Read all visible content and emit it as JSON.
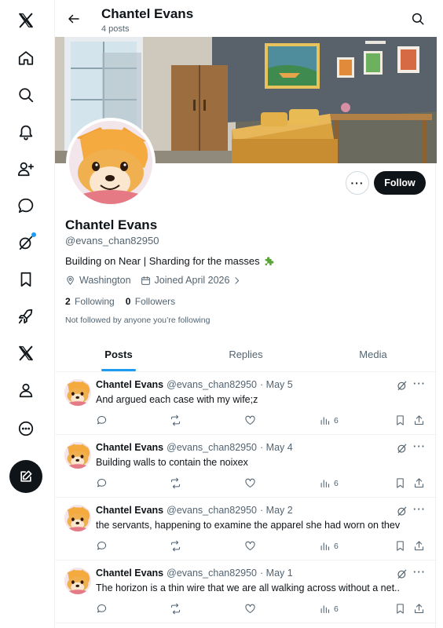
{
  "header": {
    "name": "Chantel Evans",
    "post_count": "4 posts"
  },
  "profile": {
    "name": "Chantel Evans",
    "handle": "@evans_chan82950",
    "bio": "Building on Near | Sharding for the masses",
    "location": "Washington",
    "joined": "Joined April 2026",
    "following_count": "2",
    "following_label": "Following",
    "followers_count": "0",
    "followers_label": "Followers",
    "not_followed_text": "Not followed by anyone you’re following",
    "follow_label": "Follow"
  },
  "tabs": [
    {
      "label": "Posts",
      "active": true
    },
    {
      "label": "Replies",
      "active": false
    },
    {
      "label": "Media",
      "active": false
    }
  ],
  "posts": [
    {
      "name": "Chantel Evans",
      "handle": "@evans_chan82950",
      "date": "· May 5",
      "text": "And argued each case with my wife;z",
      "views": "6"
    },
    {
      "name": "Chantel Evans",
      "handle": "@evans_chan82950",
      "date": "· May 4",
      "text": "Building walls to contain the noixex",
      "views": "6"
    },
    {
      "name": "Chantel Evans",
      "handle": "@evans_chan82950",
      "date": "· May 2",
      "text": "the servants, happening to examine the apparel she had worn on thev",
      "views": "6"
    },
    {
      "name": "Chantel Evans",
      "handle": "@evans_chan82950",
      "date": "· May 1",
      "text": "The horizon is a thin wire that we are all walking across without a net..",
      "views": "6"
    }
  ],
  "icons": {
    "sidebar": [
      "x-logo-icon",
      "home-icon",
      "explore-icon",
      "notifications-icon",
      "follow-icon",
      "messages-icon",
      "grok-icon",
      "bookmarks-icon",
      "premium-icon",
      "x-icon",
      "profile-icon",
      "more-icon",
      "compose-icon"
    ]
  },
  "colors": {
    "accent": "#1d9bf0",
    "text": "#0f1419",
    "muted": "#536471",
    "button_dark": "#0f1419"
  }
}
